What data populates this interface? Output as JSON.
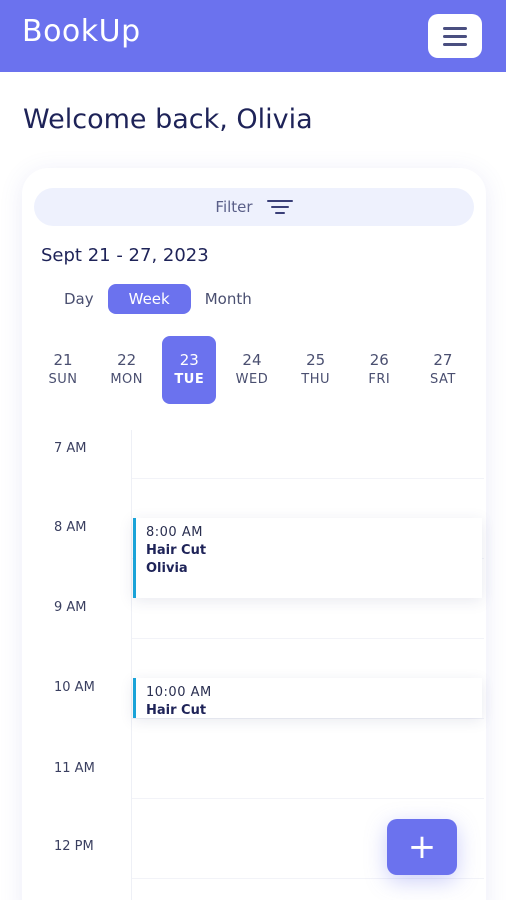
{
  "header": {
    "app_name": "BookUp",
    "menu_icon": "hamburger-menu-icon",
    "colors": {
      "primary": "#6b72ee",
      "heading": "#1e2358",
      "event_accent": "#1aa3d8"
    }
  },
  "welcome": {
    "text": "Welcome back, Olivia"
  },
  "filter": {
    "label": "Filter",
    "icon": "filter-lines-icon"
  },
  "calendar": {
    "date_range": "Sept 21 - 27, 2023",
    "view_tabs": [
      {
        "label": "Day",
        "active": false
      },
      {
        "label": "Week",
        "active": true
      },
      {
        "label": "Month",
        "active": false
      }
    ],
    "days": [
      {
        "num": "21",
        "dow": "SUN",
        "active": false
      },
      {
        "num": "22",
        "dow": "MON",
        "active": false
      },
      {
        "num": "23",
        "dow": "TUE",
        "active": true
      },
      {
        "num": "24",
        "dow": "WED",
        "active": false
      },
      {
        "num": "25",
        "dow": "THU",
        "active": false
      },
      {
        "num": "26",
        "dow": "FRI",
        "active": false
      },
      {
        "num": "27",
        "dow": "SAT",
        "active": false
      }
    ],
    "time_slots": [
      "7 AM",
      "8 AM",
      "9 AM",
      "10 AM",
      "11 AM",
      "12 PM"
    ],
    "events": [
      {
        "time": "8:00 AM",
        "service": "Hair Cut",
        "client": "Olivia"
      },
      {
        "time": "10:00 AM",
        "service": "Hair Cut",
        "client": ""
      }
    ]
  },
  "fab": {
    "label": "+",
    "icon": "plus-icon"
  }
}
